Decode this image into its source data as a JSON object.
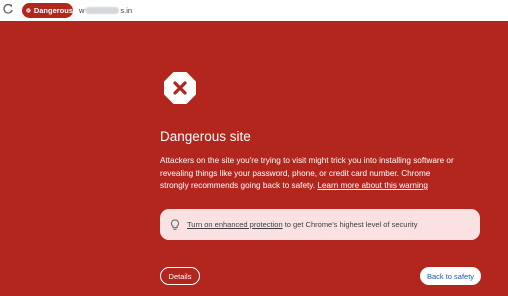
{
  "toolbar": {
    "security_chip_label": "Dangerous",
    "url_prefix": "w",
    "url_suffix": "s.in"
  },
  "interstitial": {
    "title": "Dangerous site",
    "body": "Attackers on the site you're trying to visit might trick you into installing software or revealing things like your password, phone, or credit card number. Chrome strongly recommends going back to safety.",
    "learn_more_link": "Learn more about this warning",
    "protection_link": "Turn on enhanced protection",
    "protection_text": " to get Chrome's highest level of security",
    "details_button": "Details",
    "back_button": "Back to safety"
  },
  "colors": {
    "background": "#b3261e",
    "chip": "#b3261e",
    "protection_box": "#fbe2e2",
    "back_button_text": "#1a56c4"
  },
  "icons": {
    "reload": "reload-icon",
    "chip": "danger-x-icon",
    "warning": "warning-octagon-x-icon",
    "bulb": "lightbulb-icon"
  }
}
